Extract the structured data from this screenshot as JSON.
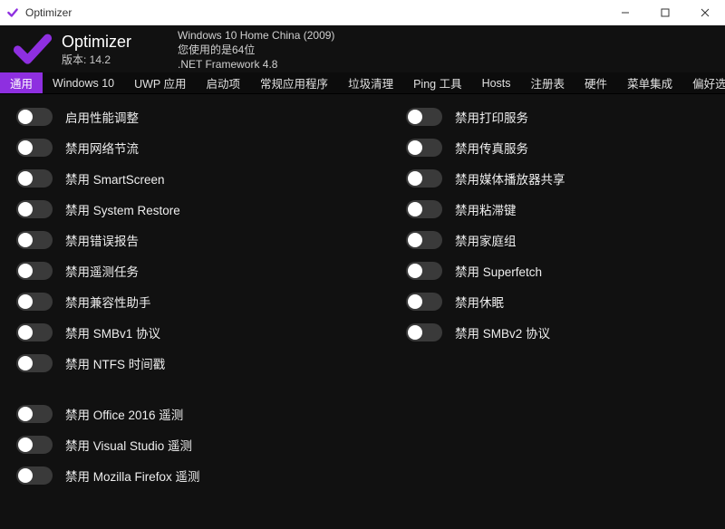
{
  "window": {
    "title": "Optimizer",
    "icon": "check-icon"
  },
  "header": {
    "app_name": "Optimizer",
    "version_prefix": "版本: ",
    "version": "14.2",
    "os_line": "Windows 10 Home China (2009)",
    "arch_line": "您使用的是64位",
    "net_line": ".NET Framework 4.8"
  },
  "accent_color": "#8e2fe0",
  "tabs": [
    {
      "label": "通用",
      "active": true
    },
    {
      "label": "Windows 10",
      "active": false
    },
    {
      "label": "UWP 应用",
      "active": false
    },
    {
      "label": "启动项",
      "active": false
    },
    {
      "label": "常规应用程序",
      "active": false
    },
    {
      "label": "垃圾清理",
      "active": false
    },
    {
      "label": "Ping 工具",
      "active": false
    },
    {
      "label": "Hosts",
      "active": false
    },
    {
      "label": "注册表",
      "active": false
    },
    {
      "label": "硬件",
      "active": false
    },
    {
      "label": "菜单集成",
      "active": false
    },
    {
      "label": "偏好选项",
      "active": false
    }
  ],
  "toggles_left_a": [
    {
      "label": "启用性能调整",
      "on": false
    },
    {
      "label": "禁用网络节流",
      "on": false
    },
    {
      "label": "禁用 SmartScreen",
      "on": false
    },
    {
      "label": "禁用 System Restore",
      "on": false
    },
    {
      "label": "禁用错误报告",
      "on": false
    },
    {
      "label": "禁用遥测任务",
      "on": false
    },
    {
      "label": "禁用兼容性助手",
      "on": false
    },
    {
      "label": "禁用 SMBv1 协议",
      "on": false
    },
    {
      "label": "禁用 NTFS 时间戳",
      "on": false
    }
  ],
  "toggles_left_b": [
    {
      "label": "禁用 Office 2016 遥测",
      "on": false
    },
    {
      "label": "禁用 Visual Studio 遥测",
      "on": false
    },
    {
      "label": "禁用 Mozilla Firefox 遥测",
      "on": false
    }
  ],
  "toggles_right": [
    {
      "label": "禁用打印服务",
      "on": false
    },
    {
      "label": "禁用传真服务",
      "on": false
    },
    {
      "label": "禁用媒体播放器共享",
      "on": false
    },
    {
      "label": "禁用粘滞键",
      "on": false
    },
    {
      "label": "禁用家庭组",
      "on": false
    },
    {
      "label": "禁用 Superfetch",
      "on": false
    },
    {
      "label": "禁用休眠",
      "on": false
    },
    {
      "label": "禁用 SMBv2 协议",
      "on": false
    }
  ]
}
